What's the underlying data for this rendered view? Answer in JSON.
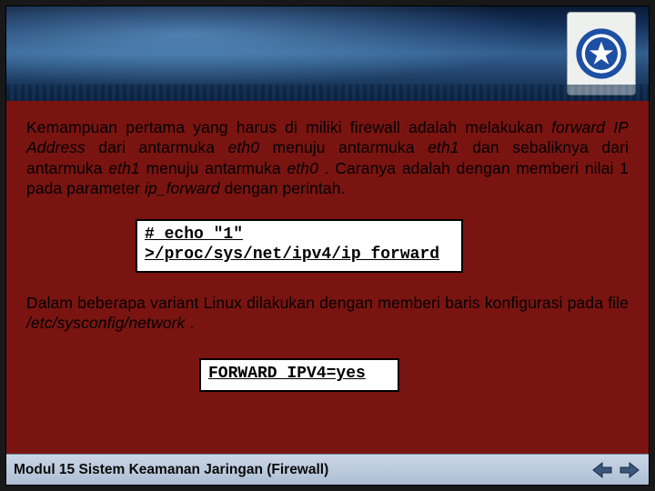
{
  "header": {
    "logo_name": "tut-wuri-handayani-logo"
  },
  "content": {
    "para1_parts": [
      {
        "t": "Kemampuan pertama yang harus di miliki firewall adalah melakukan ",
        "i": false
      },
      {
        "t": "forward IP Address",
        "i": true
      },
      {
        "t": " dari antarmuka ",
        "i": false
      },
      {
        "t": "eth0",
        "i": true
      },
      {
        "t": " menuju antarmuka ",
        "i": false
      },
      {
        "t": "eth1",
        "i": true
      },
      {
        "t": " dan sebaliknya dari antarmuka ",
        "i": false
      },
      {
        "t": "eth1",
        "i": true
      },
      {
        "t": " menuju antarmuka ",
        "i": false
      },
      {
        "t": "eth0",
        "i": true
      },
      {
        "t": " . Caranya adalah dengan memberi nilai 1 pada parameter ",
        "i": false
      },
      {
        "t": "ip_forward",
        "i": true
      },
      {
        "t": " dengan perintah.",
        "i": false
      }
    ],
    "code1": "# echo \"1\"\n>/proc/sys/net/ipv4/ip_forward",
    "para2_parts": [
      {
        "t": "Dalam beberapa variant Linux dilakukan dengan memberi baris konfigurasi pada file ",
        "i": false
      },
      {
        "t": "/etc/sysconfig/network",
        "i": true
      },
      {
        "t": " .",
        "i": false
      }
    ],
    "code2": "FORWARD_IPV4=yes"
  },
  "footer": {
    "text": "Modul 15 Sistem Keamanan Jaringan (Firewall)",
    "prev_label": "previous-slide",
    "next_label": "next-slide"
  }
}
